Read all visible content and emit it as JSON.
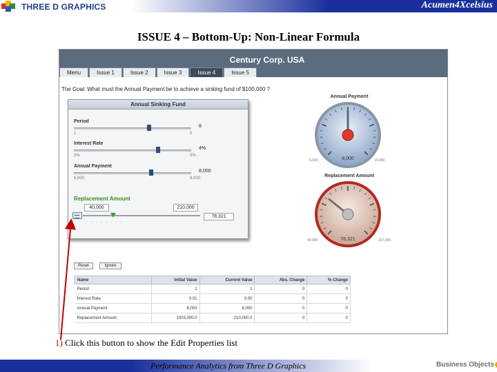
{
  "header": {
    "logo_text": "THREE D GRAPHICS",
    "brand_right": "Acumen4Xcelsius",
    "title": "ISSUE 4 – Bottom-Up: Non-Linear Formula"
  },
  "dashboard": {
    "company": "Century Corp. USA",
    "tabs": [
      "Menu",
      "Issue 1",
      "Issue 2",
      "Issue 3",
      "Issue 4",
      "Issue 5"
    ],
    "active_tab_index": 4,
    "goal_text": "The Goal: What must the Annual Payment be to achieve a sinking fund of $100,000 ?",
    "sinking_fund": {
      "title": "Annual Sinking Fund",
      "sliders": [
        {
          "label": "Period",
          "value": "8",
          "min": "1",
          "max": "0",
          "fraction": 0.64
        },
        {
          "label": "Interest Rate",
          "value": "4%",
          "min": "2%",
          "max": "5%",
          "fraction": 0.72
        },
        {
          "label": "Annual Payment",
          "value": "8,000",
          "min": "6,000",
          "max": "9,000",
          "fraction": 0.66
        }
      ],
      "replacement": {
        "title": "Replacement Amount",
        "min_box": "40,000",
        "max_box": "210,000",
        "value_box": "78,321",
        "fraction": 0.26
      }
    },
    "gauges": [
      {
        "title": "Annual Payment",
        "value": "8,000",
        "min": "6,000",
        "max": "10,000",
        "fraction": 0.5,
        "color": "#e03b2a"
      },
      {
        "title": "Replacement Amount",
        "value": "78,321",
        "min": "40,000",
        "max": "167,000",
        "fraction": 0.31,
        "color": "#bfbfbf"
      }
    ],
    "buttons": {
      "reset": "Reset",
      "ignore": "Ignore"
    },
    "table": {
      "headers": [
        "Name",
        "Initial Value",
        "Current Value",
        "Abs. Change",
        "% Change"
      ],
      "rows": [
        [
          "Period",
          "1",
          "1",
          "0",
          "0"
        ],
        [
          "Interest Rate",
          "0.01",
          "0.00",
          "0",
          "0"
        ],
        [
          "Annual Payment",
          "8,000",
          "8,000",
          "0",
          "0"
        ],
        [
          "Replacement Amount",
          "1003,000.0",
          "210,000.0",
          "0",
          "0"
        ]
      ]
    }
  },
  "callout": {
    "number": "1)",
    "text": " Click this button to show the Edit Properties list"
  },
  "footer": {
    "text": "Performance Analytics from Three D Graphics",
    "logo": "Business Objects",
    "colors": {
      "band": "#1a2f9c",
      "accent": "#c00000"
    }
  }
}
